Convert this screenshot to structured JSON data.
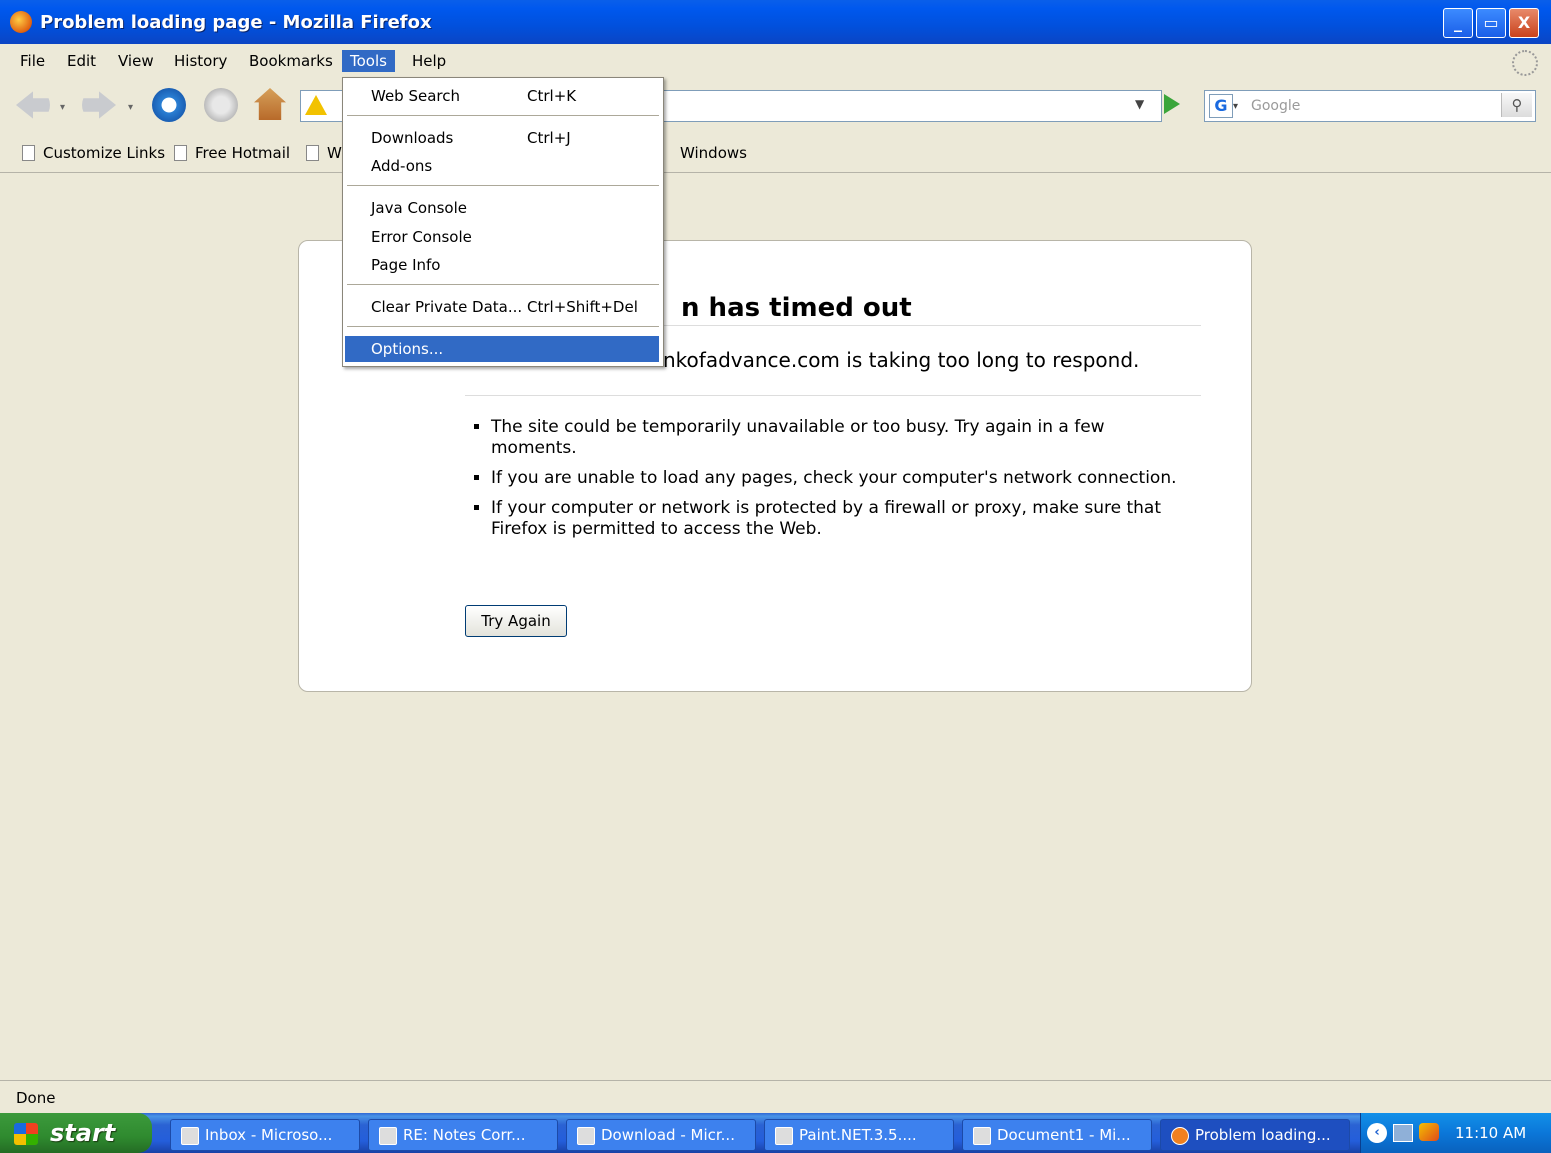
{
  "window": {
    "title": "Problem loading page - Mozilla Firefox",
    "controls": {
      "minimize": "_",
      "maximize": "▭",
      "close": "X"
    }
  },
  "menubar": {
    "items": [
      "File",
      "Edit",
      "View",
      "History",
      "Bookmarks",
      "Tools",
      "Help"
    ],
    "active": "Tools"
  },
  "navbar": {
    "search_placeholder": "Google",
    "search_engine_icon": "G"
  },
  "bookmarks": [
    "Customize Links",
    "Free Hotmail",
    "W",
    "Windows"
  ],
  "tools_menu": {
    "items": [
      {
        "label": "Web Search",
        "shortcut": "Ctrl+K"
      },
      {
        "label": "Downloads",
        "shortcut": "Ctrl+J"
      },
      {
        "label": "Add-ons",
        "shortcut": ""
      },
      {
        "label": "Java Console",
        "shortcut": ""
      },
      {
        "label": "Error Console",
        "shortcut": ""
      },
      {
        "label": "Page Info",
        "shortcut": ""
      },
      {
        "label": "Clear Private Data...",
        "shortcut": "Ctrl+Shift+Del"
      },
      {
        "label": "Options...",
        "shortcut": ""
      }
    ],
    "highlighted": "Options..."
  },
  "error_page": {
    "title": "n has timed out",
    "description": "nkofadvance.com is taking too long to respond.",
    "bullets": [
      "The site could be temporarily unavailable or too busy. Try again in a few moments.",
      "If you are unable to load any pages, check your computer's network connection.",
      "If your computer or network is protected by a firewall or proxy, make sure that Firefox is permitted to access the Web."
    ],
    "button": "Try Again"
  },
  "status": {
    "text": "Done"
  },
  "taskbar": {
    "start_label": "start",
    "tasks": [
      "Inbox - Microso...",
      "RE: Notes Corr...",
      "Download - Micr...",
      "Paint.NET.3.5....",
      "Document1 - Mi...",
      "Problem loading..."
    ],
    "active_task": "Problem loading...",
    "clock": "11:10 AM"
  },
  "colors": {
    "titlebar": "#0058EE",
    "highlight": "#316AC5",
    "chrome": "#ECE9D8",
    "taskbar": "#245EDB",
    "start": "#2F8A2F"
  }
}
